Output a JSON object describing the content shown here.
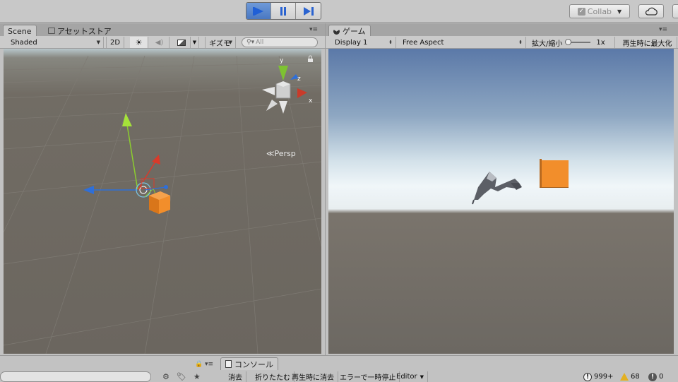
{
  "toolbar": {
    "collab_label": "Collab",
    "play_icon": "play-icon",
    "pause_icon": "pause-icon",
    "step_icon": "step-icon",
    "cloud_icon": "cloud-icon"
  },
  "scene": {
    "tab_label": "Scene",
    "asset_store_tab_label": "アセットストア",
    "shading_mode": "Shaded",
    "mode_2d_label": "2D",
    "gizmos_label": "ギズモ",
    "search_placeholder": "All",
    "axis_y": "y",
    "axis_z": "z",
    "axis_x": "x",
    "persp_label": "Persp"
  },
  "game": {
    "tab_label": "ゲーム",
    "display_label": "Display 1",
    "aspect_label": "Free Aspect",
    "scale_label": "拡大/縮小",
    "scale_value": "1x",
    "maximize_label": "再生時に最大化"
  },
  "console": {
    "tab_label": "コンソール",
    "clear_label": "消去",
    "collapse_label": "折りたたむ",
    "clear_on_play_label": "再生時に消去",
    "error_pause_label": "エラーで一時停止",
    "editor_label": "Editor",
    "info_count": "999+",
    "warning_count": "68",
    "error_count": "0"
  },
  "colors": {
    "play_active": "#4a78c2",
    "cube_orange": "#f28e2b",
    "sky_top": "#5b79a8",
    "horizon": "#eef4f8",
    "ground": "#6c6862"
  }
}
